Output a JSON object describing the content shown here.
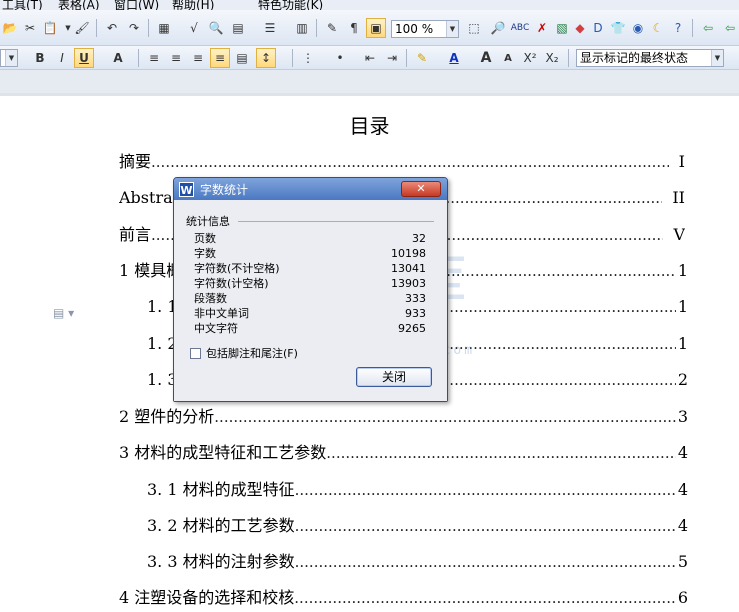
{
  "menu": {
    "items": [
      "工具(T)",
      "表格(A)",
      "窗口(W)",
      "帮助(H)",
      "特色功能(K)"
    ]
  },
  "toolbar1": {
    "zoom": "100 %"
  },
  "toolbar2": {
    "tracking_mode": "显示标记的最终状态",
    "bold": "B",
    "italic": "I",
    "underline": "U",
    "superscript": "X²",
    "subscript": "X₂",
    "grow_font": "A",
    "shrink_font": "A",
    "font_color": "A"
  },
  "document": {
    "title": "目录",
    "toc": [
      {
        "label": "摘要",
        "page": "I"
      },
      {
        "label": "Abstract",
        "page": "II"
      },
      {
        "label": "前言",
        "page": "V"
      },
      {
        "label": "1 模具概述",
        "page": "1"
      },
      {
        "label": "1. 1",
        "page": "1"
      },
      {
        "label": "1. 2",
        "page": "1"
      },
      {
        "label": "1. 3",
        "page": "2"
      },
      {
        "label": "2 塑件的分析",
        "page": "3"
      },
      {
        "label": "3 材料的成型特征和工艺参数",
        "page": "4"
      },
      {
        "label": "3. 1 材料的成型特征",
        "page": "4"
      },
      {
        "label": "3. 2 材料的工艺参数",
        "page": "4"
      },
      {
        "label": "3. 3 材料的注射参数",
        "page": "5"
      },
      {
        "label": "4 注塑设备的选择和校核",
        "page": "6"
      }
    ]
  },
  "watermark": {
    "text": "人人文库",
    "url": "www.renrendoc.com"
  },
  "dialog": {
    "title": "字数统计",
    "close_glyph": "✕",
    "group_label": "统计信息",
    "stats": [
      {
        "label": "页数",
        "value": "32"
      },
      {
        "label": "字数",
        "value": "10198"
      },
      {
        "label": "字符数(不计空格)",
        "value": "13041"
      },
      {
        "label": "字符数(计空格)",
        "value": "13903"
      },
      {
        "label": "段落数",
        "value": "333"
      },
      {
        "label": "非中文单词",
        "value": "933"
      },
      {
        "label": "中文字符",
        "value": "9265"
      }
    ],
    "checkbox_label": "包括脚注和尾注(F)",
    "close_button": "关闭"
  },
  "colors": {
    "title_bar": "#4a78c2",
    "close_red": "#c63a24",
    "watermark": "#5a86c8"
  }
}
